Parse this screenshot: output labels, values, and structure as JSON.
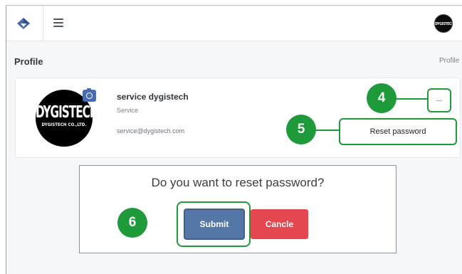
{
  "topbar": {
    "logo_icon": "diamond-logo-icon",
    "menu_icon": "hamburger-icon",
    "avatar_text": "DYGISTECH"
  },
  "page": {
    "title": "Profile",
    "breadcrumb": "Profile"
  },
  "profile": {
    "avatar_big_text": "DYGISTECH",
    "avatar_small_text": "DYGISTECH CO.,LTD.",
    "camera_icon": "camera-icon",
    "name": "service dygistech",
    "role": "Service",
    "email": "service@dygistech.com"
  },
  "menu": {
    "more_label": "...",
    "reset_password_label": "Reset password"
  },
  "dialog": {
    "question": "Do you want to reset password?",
    "submit_label": "Submit",
    "cancel_label": "Cancle"
  },
  "callouts": {
    "step_more": "4",
    "step_reset": "5",
    "step_submit": "6"
  },
  "colors": {
    "callout_green": "#1f9a3b",
    "submit_blue": "#5477a8",
    "cancel_red": "#e4474f",
    "camera_blue": "#4a6bb0"
  }
}
